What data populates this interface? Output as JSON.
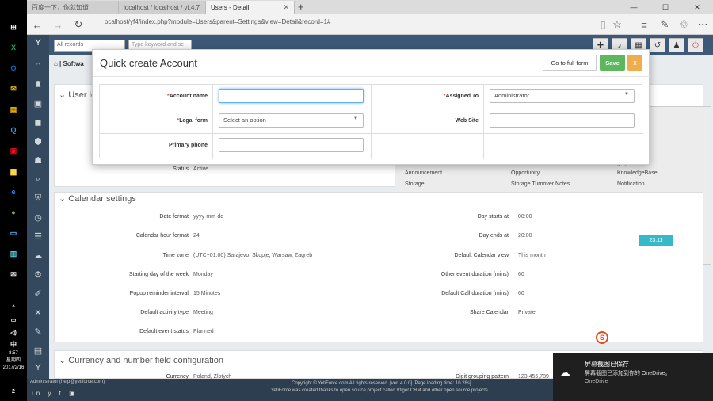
{
  "taskbar": {
    "clock_time": "8:57",
    "clock_day": "星期四",
    "clock_date": "2017/2/16",
    "ime": "中",
    "notifications": "2"
  },
  "browser": {
    "tabs": [
      {
        "label": "百度一下，你就知道",
        "active": false
      },
      {
        "label": "localhost / localhost / yf.4.7",
        "active": false
      },
      {
        "label": "Users - Detail",
        "active": true
      }
    ],
    "new_tab": "+",
    "url": "ocalhost/yf4/index.php?module=Users&parent=Settings&view=Detail&record=1#"
  },
  "app": {
    "record_selector": "All records",
    "search_placeholder": "Type keyword and se",
    "breadcrumb": "Softwa",
    "section_user": "User lo",
    "status_label": "Status",
    "status_value": "Active",
    "overlay_items": [
      {
        "label": "Announcement"
      },
      {
        "label": "Opportunity"
      },
      {
        "label": "KnowledgeBase"
      },
      {
        "label": "Storage"
      },
      {
        "label": "Storage Turnover Notes"
      },
      {
        "label": "Notification"
      }
    ],
    "overlay_fragments": [
      "ut",
      "e",
      "ging"
    ],
    "calendar_title": "Calendar settings",
    "calendar_rows_left": [
      {
        "label": "Date format",
        "value": "yyyy-mm-dd"
      },
      {
        "label": "Calendar hour format",
        "value": "24"
      },
      {
        "label": "Time zone",
        "value": "(UTC+01:00) Sarajevo, Skopje, Warsaw, Zagreb"
      },
      {
        "label": "Starting day of the week",
        "value": "Monday"
      },
      {
        "label": "Popup reminder interval",
        "value": "15 Minutes"
      },
      {
        "label": "Default activity type",
        "value": "Meeting"
      },
      {
        "label": "Default event status",
        "value": "Planned"
      }
    ],
    "calendar_rows_right": [
      {
        "label": "Day starts at",
        "value": "08:00"
      },
      {
        "label": "Day ends at",
        "value": "20:00"
      },
      {
        "label": "Default Calendar view",
        "value": "This month"
      },
      {
        "label": "Other event duration (mins)",
        "value": "60"
      },
      {
        "label": "Default Call duration (mins)",
        "value": "60"
      },
      {
        "label": "Share Calendar",
        "value": "Private"
      }
    ],
    "currency_title": "Currency and number field configuration",
    "currency_label": "Currency",
    "currency_value": "Poland, Zlotych",
    "digit_label": "Digit grouping pattern",
    "digit_value": "123,456,789",
    "footer_user": "Administrator (help@yetiforce.com)",
    "footer_copyright": "Copyright © YetiForce.com All rights reserved. [ver. 4.0.0] [Page loading time: 10.28s]",
    "footer_note": "YetiForce was created thanks to open source project called Vtiger CRM and other open source projects.",
    "widget_text": "23.11"
  },
  "modal": {
    "title": "Quick create Account",
    "full_form_label": "Go to full form",
    "save_label": "Save",
    "close_label": "x",
    "fields": {
      "account_name": {
        "label": "Account name",
        "required": "*",
        "value": ""
      },
      "assigned_to": {
        "label": "Assigned To",
        "required": "*",
        "value": "Administrator"
      },
      "legal_form": {
        "label": "Legal form",
        "required": "*",
        "placeholder": "Select an option"
      },
      "website": {
        "label": "Web Site",
        "value": ""
      },
      "primary_phone": {
        "label": "Primary phone",
        "value": ""
      }
    }
  },
  "toast": {
    "title": "屏幕截图已保存",
    "body": "屏幕截图已添加到你的 OneDrive。",
    "source": "OneDrive"
  },
  "colors": {
    "save": "#5cb85c",
    "close": "#f0ad4e",
    "nav": "#34495e",
    "topbar": "#3c5a78"
  }
}
